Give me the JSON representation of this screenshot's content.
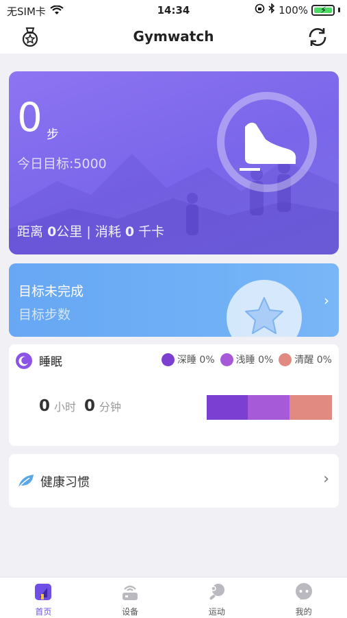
{
  "status_bar": {
    "carrier": "无SIM卡",
    "time": "14:34",
    "battery": "100%"
  },
  "header": {
    "title": "Gymwatch"
  },
  "steps_card": {
    "value": "0",
    "unit": "步",
    "goal_label": "今日目标:5000",
    "stats_label_distance": "距离",
    "distance_value": "0",
    "distance_unit": "公里",
    "separator": "|",
    "stats_label_calories": "消耗",
    "calories_value": "0",
    "calories_unit": "千卡"
  },
  "goal_card": {
    "title": "目标未完成",
    "subtitle": "目标步数"
  },
  "sleep_card": {
    "title": "睡眠",
    "legend": [
      {
        "label": "深睡 0%",
        "color": "#7b3fd1"
      },
      {
        "label": "浅睡 0%",
        "color": "#a65ad8"
      },
      {
        "label": "清醒 0%",
        "color": "#e08a82"
      }
    ],
    "hours": "0",
    "hours_unit": "小时",
    "minutes": "0",
    "minutes_unit": "分钟"
  },
  "habit_card": {
    "label": "健康习惯"
  },
  "tabs": [
    {
      "label": "首页",
      "icon": "home-icon",
      "active": true
    },
    {
      "label": "设备",
      "icon": "device-icon",
      "active": false
    },
    {
      "label": "运动",
      "icon": "sport-icon",
      "active": false
    },
    {
      "label": "我的",
      "icon": "profile-icon",
      "active": false
    }
  ],
  "colors": {
    "primary": "#7a66ea",
    "goal_blue": "#6fb0f6",
    "active_tab": "#6f4fe6"
  }
}
